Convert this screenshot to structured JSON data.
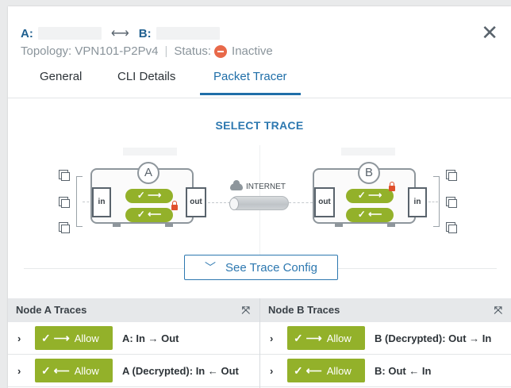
{
  "header": {
    "a_label": "A:",
    "b_label": "B:",
    "arrow": "⟷",
    "topology": "Topology: VPN101-P2Pv4",
    "separator": "|",
    "status_label": "Status:",
    "status_value": "Inactive",
    "close_icon": "close-icon",
    "status_color": "#e8694a"
  },
  "tabs": [
    {
      "label": "General",
      "active": false
    },
    {
      "label": "CLI Details",
      "active": false
    },
    {
      "label": "Packet Tracer",
      "active": true
    }
  ],
  "trace": {
    "title": "SELECT TRACE",
    "internet_label": "INTERNET",
    "node_a": {
      "badge": "A",
      "in": "in",
      "out": "out"
    },
    "node_b": {
      "badge": "B",
      "in": "in",
      "out": "out"
    },
    "config_button": "See Trace Config"
  },
  "tables": {
    "node_a": {
      "title": "Node A Traces",
      "rows": [
        {
          "chevron": "›",
          "icon": "✓ ⟶",
          "button": "Allow",
          "label": "A: In → Out"
        },
        {
          "chevron": "›",
          "icon": "✓ ⟵",
          "button": "Allow",
          "label": "A (Decrypted): In ← Out"
        }
      ]
    },
    "node_b": {
      "title": "Node B Traces",
      "rows": [
        {
          "chevron": "›",
          "icon": "✓ ⟶",
          "button": "Allow",
          "label": "B (Decrypted): Out → In"
        },
        {
          "chevron": "›",
          "icon": "✓ ⟵",
          "button": "Allow",
          "label": "B: Out ← In"
        }
      ]
    }
  },
  "colors": {
    "accent": "#1f6ea8",
    "allow_green": "#93b12a",
    "lock_red": "#e0502c"
  }
}
